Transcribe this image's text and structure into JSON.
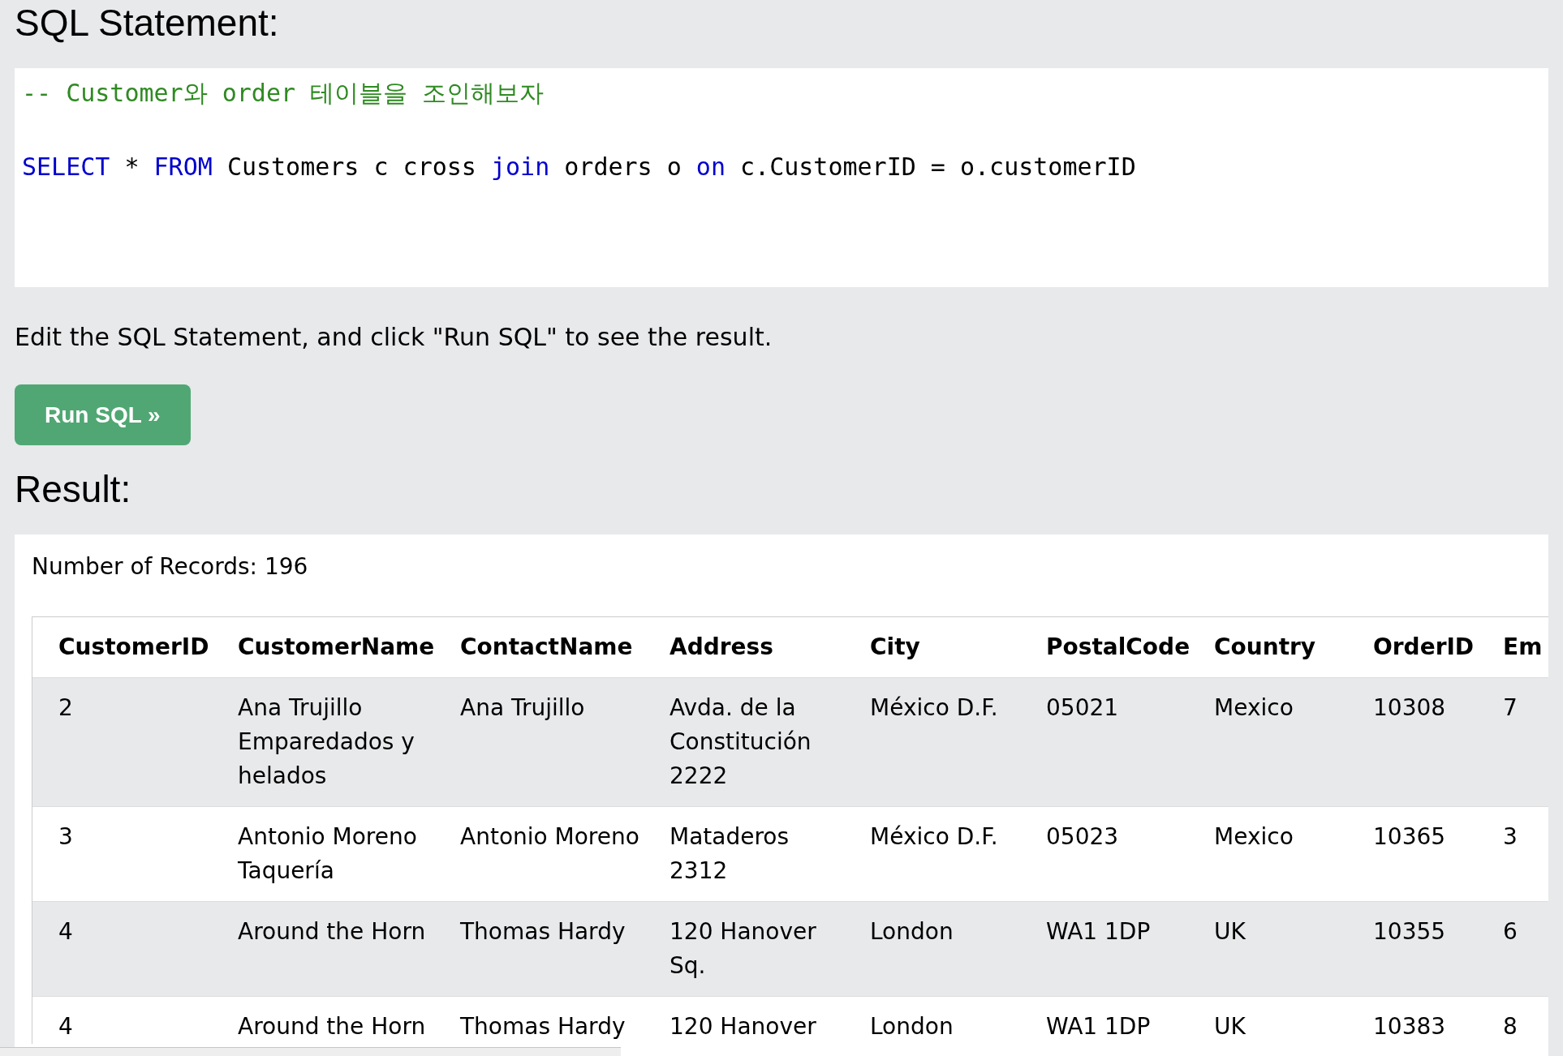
{
  "sql_panel": {
    "title": "SQL Statement:",
    "code_lines": [
      {
        "tokens": [
          {
            "kind": "comment",
            "text": "-- Customer와 order 테이블을 조인해보자"
          }
        ]
      },
      {
        "tokens": [
          {
            "kind": "keyword",
            "text": "SELECT"
          },
          {
            "kind": "plain",
            "text": "*"
          },
          {
            "kind": "keyword",
            "text": "FROM"
          },
          {
            "kind": "plain",
            "text": "Customers c cross"
          },
          {
            "kind": "keyword",
            "text": "join"
          },
          {
            "kind": "plain",
            "text": "orders o"
          },
          {
            "kind": "keyword",
            "text": "on"
          },
          {
            "kind": "plain",
            "text": "c.CustomerID = o.customerID"
          }
        ]
      }
    ]
  },
  "instruction": "Edit the SQL Statement, and click \"Run SQL\" to see the result.",
  "run_button": {
    "label": "Run SQL »"
  },
  "result": {
    "title": "Result:",
    "record_count": "Number of Records: 196",
    "table": {
      "columns": [
        "CustomerID",
        "CustomerName",
        "ContactName",
        "Address",
        "City",
        "PostalCode",
        "Country",
        "OrderID",
        "Em"
      ],
      "rows": [
        [
          "2",
          "Ana Trujillo Emparedados y helados",
          "Ana Trujillo",
          "Avda. de la Constitución 2222",
          "México D.F.",
          "05021",
          "Mexico",
          "10308",
          "7"
        ],
        [
          "3",
          "Antonio Moreno Taquería",
          "Antonio Moreno",
          "Mataderos 2312",
          "México D.F.",
          "05023",
          "Mexico",
          "10365",
          "3"
        ],
        [
          "4",
          "Around the Horn",
          "Thomas Hardy",
          "120 Hanover Sq.",
          "London",
          "WA1 1DP",
          "UK",
          "10355",
          "6"
        ],
        [
          "4",
          "Around the Horn",
          "Thomas Hardy",
          "120 Hanover",
          "London",
          "WA1 1DP",
          "UK",
          "10383",
          "8"
        ]
      ]
    }
  }
}
